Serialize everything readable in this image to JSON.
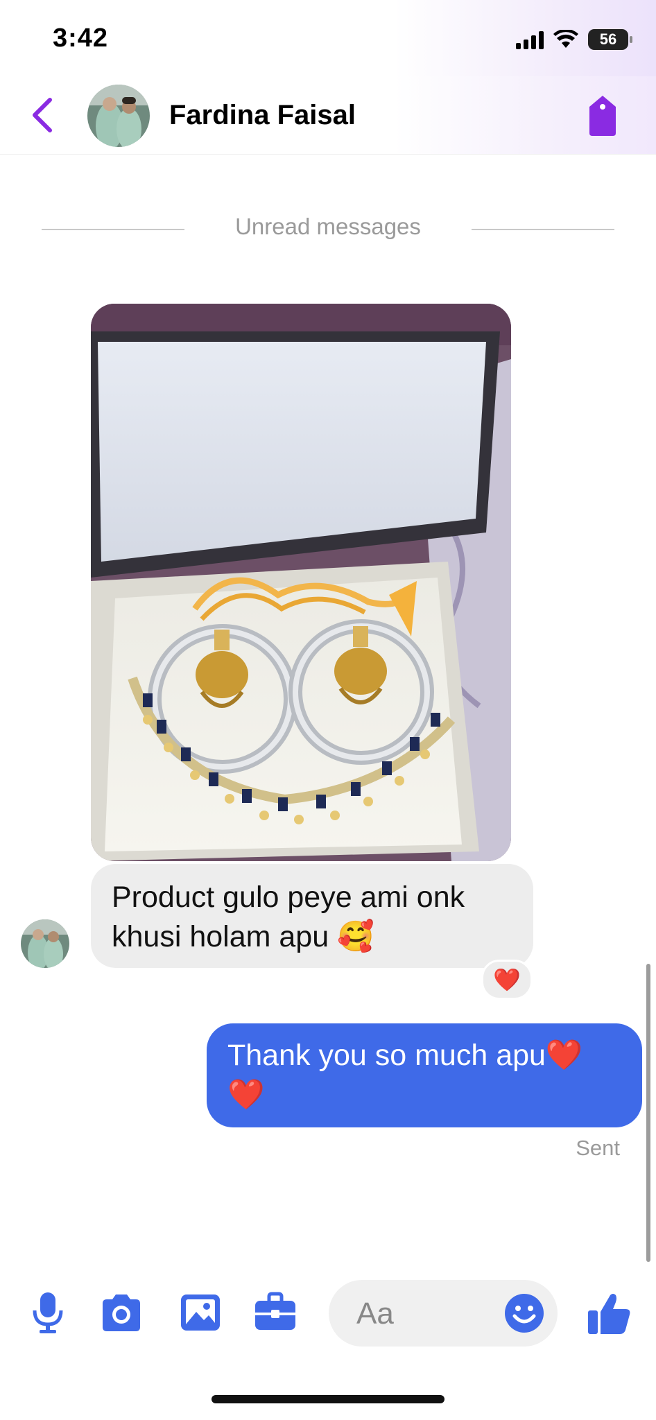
{
  "status": {
    "time": "3:42",
    "battery": "56"
  },
  "header": {
    "contact_name": "Fardina Faisal"
  },
  "divider_label": "Unread messages",
  "messages": {
    "incoming": {
      "text": "Product gulo peye ami onk khusi holam apu 🥰",
      "reaction": "❤️"
    },
    "outgoing": {
      "text": "Thank you so much apu❤️ ❤️",
      "status": "Sent"
    }
  },
  "composer": {
    "placeholder": "Aa"
  },
  "colors": {
    "accent": "#3f6ae8",
    "header_icon": "#8a2be2",
    "outgoing_bubble": "#3f6ae8",
    "incoming_bubble": "#ededed"
  },
  "icons": [
    "back-arrow-icon",
    "tag-icon",
    "microphone-icon",
    "camera-icon",
    "gallery-icon",
    "briefcase-icon",
    "emoji-icon",
    "thumbs-up-icon"
  ]
}
